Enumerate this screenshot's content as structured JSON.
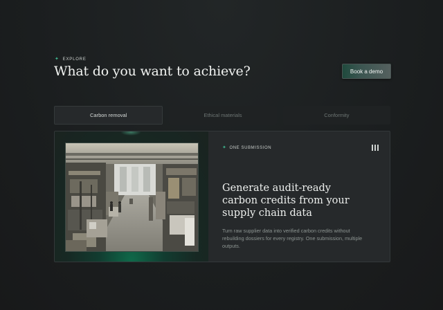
{
  "header": {
    "eyebrow": "EXPLORE",
    "title": "What do you want to achieve?",
    "cta_label": "Book a demo"
  },
  "tabs": [
    {
      "label": "Carbon removal",
      "active": true
    },
    {
      "label": "Ethical materials",
      "active": false
    },
    {
      "label": "Conformity",
      "active": false
    }
  ],
  "card": {
    "eyebrow": "ONE SUBMISSION",
    "title": "Generate audit-ready carbon credits from your supply chain data",
    "description": "Turn raw supplier data into verified carbon credits without rebuilding dossiers for every registry. One submission, multiple outputs.",
    "image_alt": "factory-floor-photo"
  },
  "colors": {
    "background": "#1b1e1f",
    "accent_green": "#3fb58f",
    "card": "#26292b"
  },
  "icons": [
    "sparkle-icon",
    "pause-icon"
  ]
}
